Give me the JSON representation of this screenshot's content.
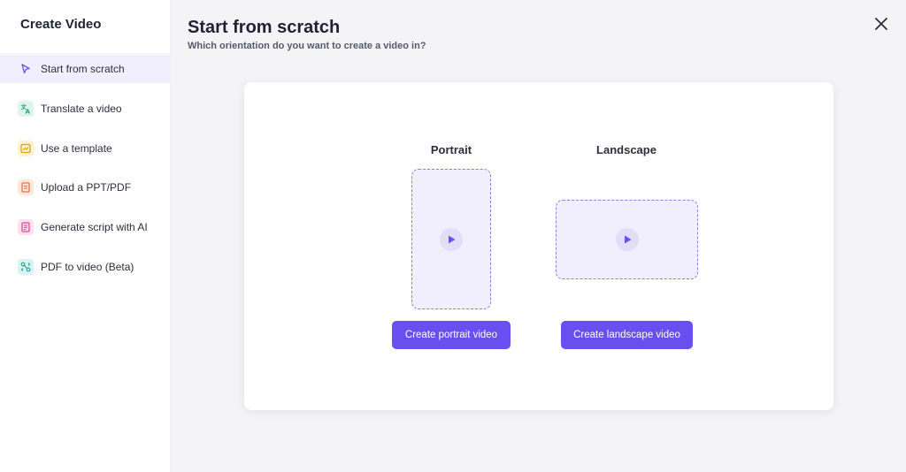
{
  "sidebar": {
    "title": "Create Video",
    "items": [
      {
        "label": "Start from scratch",
        "icon": "cursor-icon",
        "active": true,
        "color": "#6a4ff0",
        "bg": ""
      },
      {
        "label": "Translate a video",
        "icon": "translate-icon",
        "active": false,
        "color": "#1aa37a",
        "bg": "#dff5ec"
      },
      {
        "label": "Use a template",
        "icon": "template-icon",
        "active": false,
        "color": "#e0a400",
        "bg": "#fdf2d2"
      },
      {
        "label": "Upload a PPT/PDF",
        "icon": "document-icon",
        "active": false,
        "color": "#e2734a",
        "bg": "#fde6dc"
      },
      {
        "label": "Generate script with AI",
        "icon": "script-icon",
        "active": false,
        "color": "#d64d94",
        "bg": "#fbe1ee"
      },
      {
        "label": "PDF to video (Beta)",
        "icon": "pdf-video-icon",
        "active": false,
        "color": "#23a69a",
        "bg": "#daf3f0"
      }
    ]
  },
  "main": {
    "title": "Start from scratch",
    "subtitle": "Which orientation do you want to create a video in?",
    "close_icon": "close-icon"
  },
  "options": {
    "portrait": {
      "label": "Portrait",
      "button": "Create portrait video"
    },
    "landscape": {
      "label": "Landscape",
      "button": "Create landscape video"
    }
  },
  "colors": {
    "accent": "#6a4ff0",
    "preview_bg": "#f1effd",
    "preview_border": "#8b7fd9"
  }
}
